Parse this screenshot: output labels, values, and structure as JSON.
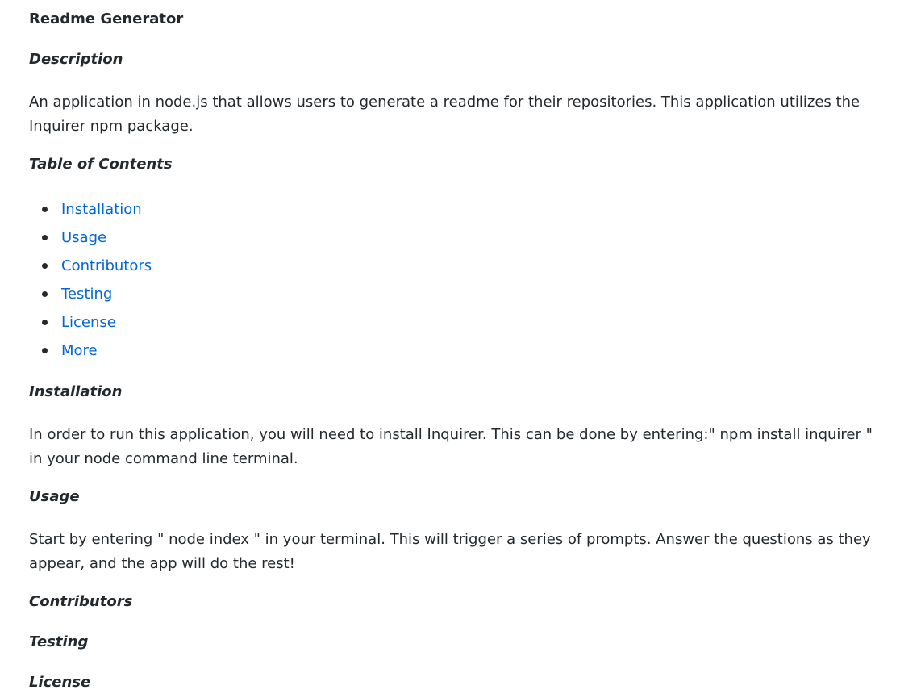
{
  "document": {
    "title": "Readme Generator",
    "description_heading": "Description",
    "description_text": "An application in node.js that allows users to generate a readme for their repositories. This application utilizes the Inquirer npm package.",
    "toc_heading": "Table of Contents",
    "toc_items": [
      {
        "label": "Installation"
      },
      {
        "label": "Usage"
      },
      {
        "label": "Contributors"
      },
      {
        "label": "Testing"
      },
      {
        "label": "License"
      },
      {
        "label": "More"
      }
    ],
    "installation_heading": "Installation",
    "installation_text": "In order to run this application, you will need to install Inquirer. This can be done by entering:\" npm install inquirer \" in your node command line terminal.",
    "usage_heading": "Usage",
    "usage_text": "Start by entering \" node index \" in your terminal. This will trigger a series of prompts. Answer the questions as they appear, and the app will do the rest!",
    "contributors_heading": "Contributors",
    "testing_heading": "Testing",
    "license_heading": "License"
  },
  "colors": {
    "text": "#24292e",
    "link": "#0366d6",
    "background": "#ffffff"
  }
}
